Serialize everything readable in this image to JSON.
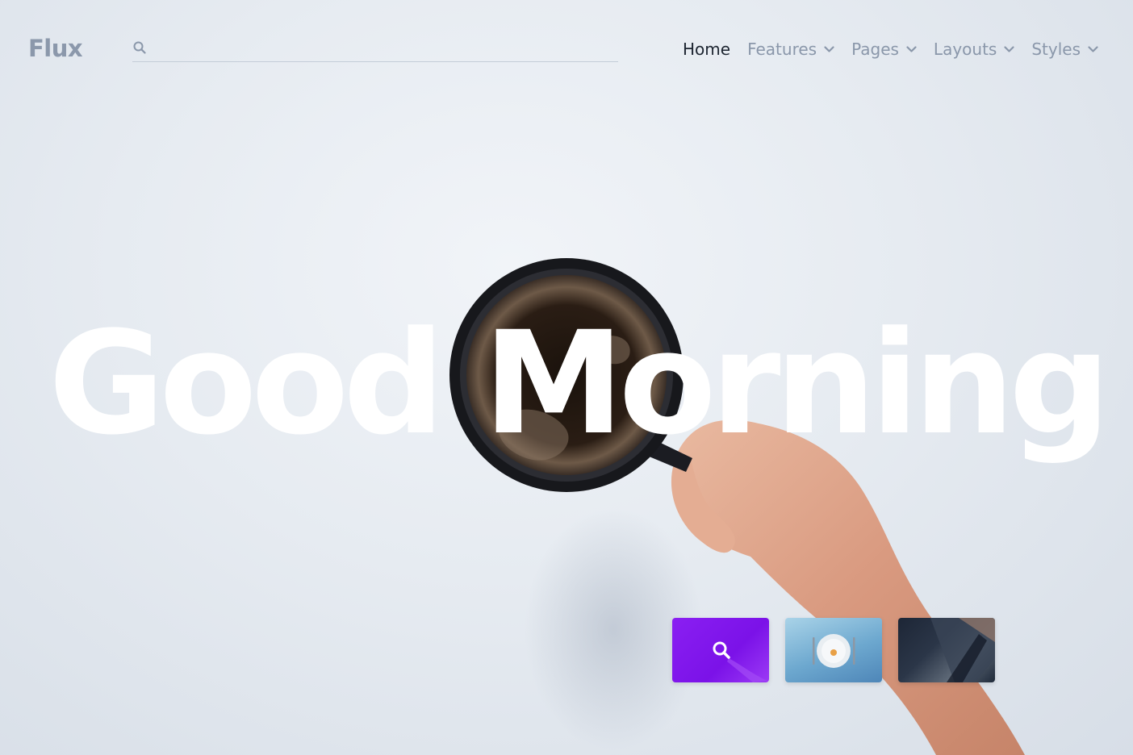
{
  "brand": {
    "name": "Flux"
  },
  "search": {
    "value": "",
    "placeholder": "",
    "icon": "search-icon"
  },
  "nav": {
    "items": [
      {
        "label": "Home",
        "active": true,
        "dropdown": false
      },
      {
        "label": "Features",
        "active": false,
        "dropdown": true
      },
      {
        "label": "Pages",
        "active": false,
        "dropdown": true
      },
      {
        "label": "Layouts",
        "active": false,
        "dropdown": true
      },
      {
        "label": "Styles",
        "active": false,
        "dropdown": true
      }
    ]
  },
  "hero": {
    "title": "Good Morning",
    "image": "coffee-mug-held-by-hand"
  },
  "thumbnails": [
    {
      "name": "search-thumbnail",
      "icon": "search-icon",
      "color": "#8a1ff2"
    },
    {
      "name": "dinner-plate-thumbnail",
      "icon": "plate-icon",
      "color": "#6da8cf"
    },
    {
      "name": "dark-abstract-thumbnail",
      "icon": "",
      "color": "#1d2636"
    }
  ],
  "colors": {
    "accent": "#8a1ff2",
    "nav_active": "#1c2430",
    "nav_inactive": "#8a97aa",
    "logo": "#8b98ab",
    "background": "#e6ebf1"
  }
}
